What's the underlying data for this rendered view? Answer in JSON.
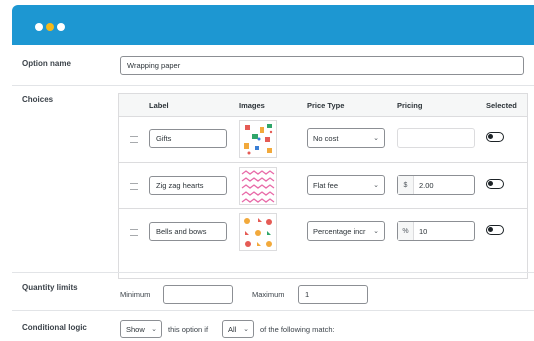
{
  "window": {
    "title_dots": [
      "white",
      "yellow",
      "white"
    ]
  },
  "option_name": {
    "label": "Option name",
    "value": "Wrapping paper"
  },
  "choices": {
    "label": "Choices",
    "columns": [
      "Label",
      "Images",
      "Price Type",
      "Pricing",
      "Selected"
    ],
    "rows": [
      {
        "label": "Gifts",
        "image": "gifts-pattern",
        "price_type": "No cost",
        "prefix": "",
        "pricing": "",
        "selected": false
      },
      {
        "label": "Zig zag hearts",
        "image": "zigzag-hearts-pattern",
        "price_type": "Flat fee",
        "prefix": "$",
        "pricing": "2.00",
        "selected": false
      },
      {
        "label": "Bells and bows",
        "image": "bells-bows-pattern",
        "price_type": "Percentage incr",
        "prefix": "%",
        "pricing": "10",
        "selected": false
      }
    ]
  },
  "quantity_limits": {
    "label": "Quantity limits",
    "min_label": "Minimum",
    "min_value": "",
    "max_label": "Maximum",
    "max_value": "1"
  },
  "conditional_logic": {
    "label": "Conditional logic",
    "action": "Show",
    "text1": "this option if",
    "match": "All",
    "text2": "of the following match:"
  },
  "colors": {
    "titlebar": "#1d97d2",
    "dot_accent": "#f5b91a"
  }
}
